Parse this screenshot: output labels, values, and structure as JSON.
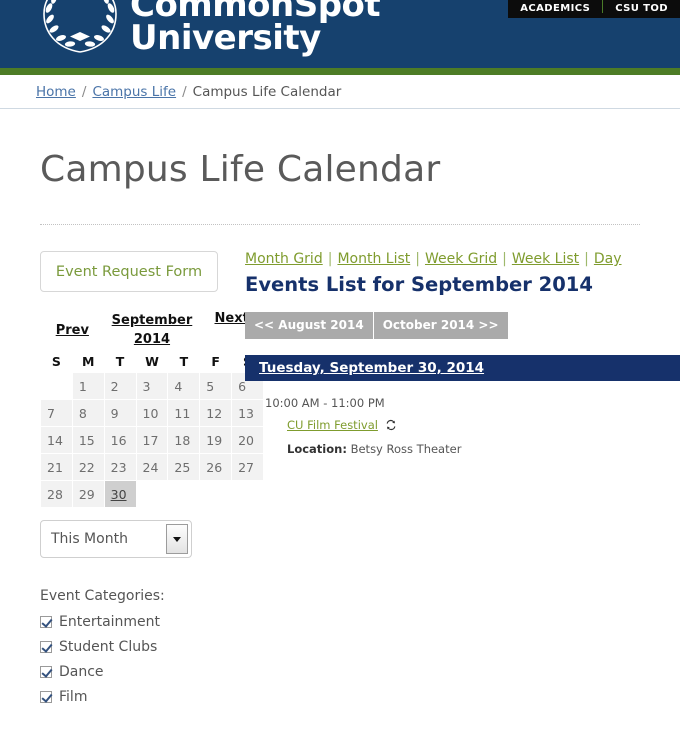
{
  "site": {
    "brand_line1": "CommonSpot",
    "brand_line2": "University",
    "logo_icon": "laurel-wreath-graduation-cap-icon",
    "utility_nav": [
      {
        "label": "ACADEMICS"
      },
      {
        "label": "CSU TOD"
      }
    ],
    "colors": {
      "header_navy": "#16416e",
      "green_rule": "#4d7c26",
      "link_green": "#7f9c2e",
      "banner_navy": "#16316b",
      "breadcrumb_link": "#4a74a8"
    }
  },
  "breadcrumb": {
    "items": [
      {
        "label": "Home",
        "link": true
      },
      {
        "label": "Campus Life",
        "link": true
      },
      {
        "label": "Campus Life Calendar",
        "link": false
      }
    ],
    "separator": "/"
  },
  "page": {
    "title": "Campus Life Calendar"
  },
  "sidebar": {
    "event_request_button": "Event Request Form",
    "calendar": {
      "prev_label": "Prev",
      "next_label": "Next",
      "month_label": "September",
      "year_label": "2014",
      "dow": [
        "S",
        "M",
        "T",
        "W",
        "T",
        "F",
        "S"
      ],
      "weeks": [
        [
          {
            "d": "",
            "state": "empty"
          },
          {
            "d": "1"
          },
          {
            "d": "2"
          },
          {
            "d": "3"
          },
          {
            "d": "4"
          },
          {
            "d": "5"
          },
          {
            "d": "6"
          }
        ],
        [
          {
            "d": "7"
          },
          {
            "d": "8"
          },
          {
            "d": "9"
          },
          {
            "d": "10"
          },
          {
            "d": "11"
          },
          {
            "d": "12"
          },
          {
            "d": "13"
          }
        ],
        [
          {
            "d": "14"
          },
          {
            "d": "15"
          },
          {
            "d": "16"
          },
          {
            "d": "17"
          },
          {
            "d": "18"
          },
          {
            "d": "19"
          },
          {
            "d": "20"
          }
        ],
        [
          {
            "d": "21"
          },
          {
            "d": "22"
          },
          {
            "d": "23"
          },
          {
            "d": "24"
          },
          {
            "d": "25"
          },
          {
            "d": "26"
          },
          {
            "d": "27"
          }
        ],
        [
          {
            "d": "28"
          },
          {
            "d": "29"
          },
          {
            "d": "30",
            "state": "today"
          },
          {
            "d": "",
            "state": "empty"
          },
          {
            "d": "",
            "state": "empty"
          },
          {
            "d": "",
            "state": "empty"
          },
          {
            "d": "",
            "state": "empty"
          }
        ]
      ]
    },
    "range_select": {
      "value": "This Month",
      "options": [
        "This Month"
      ]
    },
    "categories_title": "Event Categories:",
    "categories": [
      {
        "label": "Entertainment",
        "checked": true
      },
      {
        "label": "Student Clubs",
        "checked": true
      },
      {
        "label": "Dance",
        "checked": true
      },
      {
        "label": "Film",
        "checked": true
      }
    ]
  },
  "main": {
    "view_links": [
      {
        "label": "Month Grid"
      },
      {
        "label": "Month List"
      },
      {
        "label": "Week Grid"
      },
      {
        "label": "Week List"
      },
      {
        "label": "Day"
      }
    ],
    "view_separator": "|",
    "heading": "Events List for September 2014",
    "month_nav": {
      "prev_label": "<< August 2014",
      "next_label": "October 2014 >>"
    },
    "day_groups": [
      {
        "date_label": "Tuesday, September 30, 2014",
        "events": [
          {
            "time": "10:00 AM - 11:00 PM",
            "title": "CU Film Festival",
            "recurrence_icon": "recurring-event-icon",
            "location_label": "Location:",
            "location_value": "Betsy Ross Theater"
          }
        ]
      }
    ]
  }
}
